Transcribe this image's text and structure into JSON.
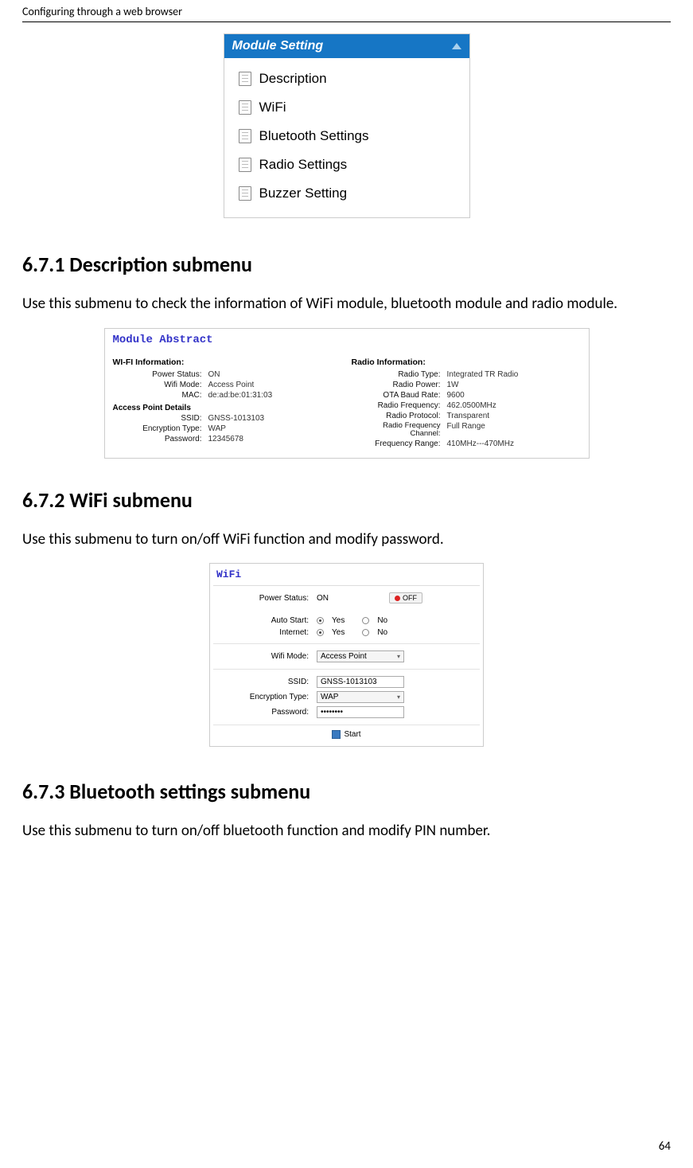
{
  "header": {
    "title": "Configuring through a web browser"
  },
  "page_number": "64",
  "module_setting": {
    "title": "Module Setting",
    "items": [
      "Description",
      "WiFi",
      "Bluetooth Settings",
      "Radio Settings",
      "Buzzer Setting"
    ]
  },
  "sections": {
    "s671": {
      "heading": "6.7.1  Description submenu",
      "text": "Use this submenu to check the information of WiFi module, bluetooth module and radio module."
    },
    "s672": {
      "heading": "6.7.2  WiFi submenu",
      "text": "Use this submenu to turn on/off WiFi function and modify password."
    },
    "s673": {
      "heading": "6.7.3  Bluetooth settings submenu",
      "text": "Use this submenu to turn on/off bluetooth function and modify PIN number."
    }
  },
  "module_abstract": {
    "title": "Module Abstract",
    "wifi_head": "WI-FI Information:",
    "wifi": {
      "power_status_l": "Power Status:",
      "power_status_v": "ON",
      "wifi_mode_l": "Wifi Mode:",
      "wifi_mode_v": "Access Point",
      "mac_l": "MAC:",
      "mac_v": "de:ad:be:01:31:03",
      "apd_head": "Access Point Details",
      "ssid_l": "SSID:",
      "ssid_v": "GNSS-1013103",
      "enc_l": "Encryption Type:",
      "enc_v": "WAP",
      "pwd_l": "Password:",
      "pwd_v": "12345678"
    },
    "radio_head": "Radio Information:",
    "radio": {
      "type_l": "Radio Type:",
      "type_v": "Integrated TR Radio",
      "power_l": "Radio Power:",
      "power_v": "1W",
      "br_l": "OTA Baud Rate:",
      "br_v": "9600",
      "freq_l": "Radio Frequency:",
      "freq_v": "462.0500MHz",
      "proto_l": "Radio Protocol:",
      "proto_v": "Transparent",
      "chan_l": "Radio Frequency Channel:",
      "chan_v": "Full Range",
      "range_l": "Frequency Range:",
      "range_v": "410MHz---470MHz"
    }
  },
  "wifi_fig": {
    "title": "WiFi",
    "power_l": "Power Status:",
    "power_v": "ON",
    "off_btn": "OFF",
    "auto_l": "Auto Start:",
    "yes": "Yes",
    "no": "No",
    "inet_l": "Internet:",
    "mode_l": "Wifi Mode:",
    "mode_v": "Access Point",
    "ssid_l": "SSID:",
    "ssid_v": "GNSS-1013103",
    "enc_l": "Encryption Type:",
    "enc_v": "WAP",
    "pwd_l": "Password:",
    "pwd_v": "••••••••",
    "start": "Start"
  }
}
